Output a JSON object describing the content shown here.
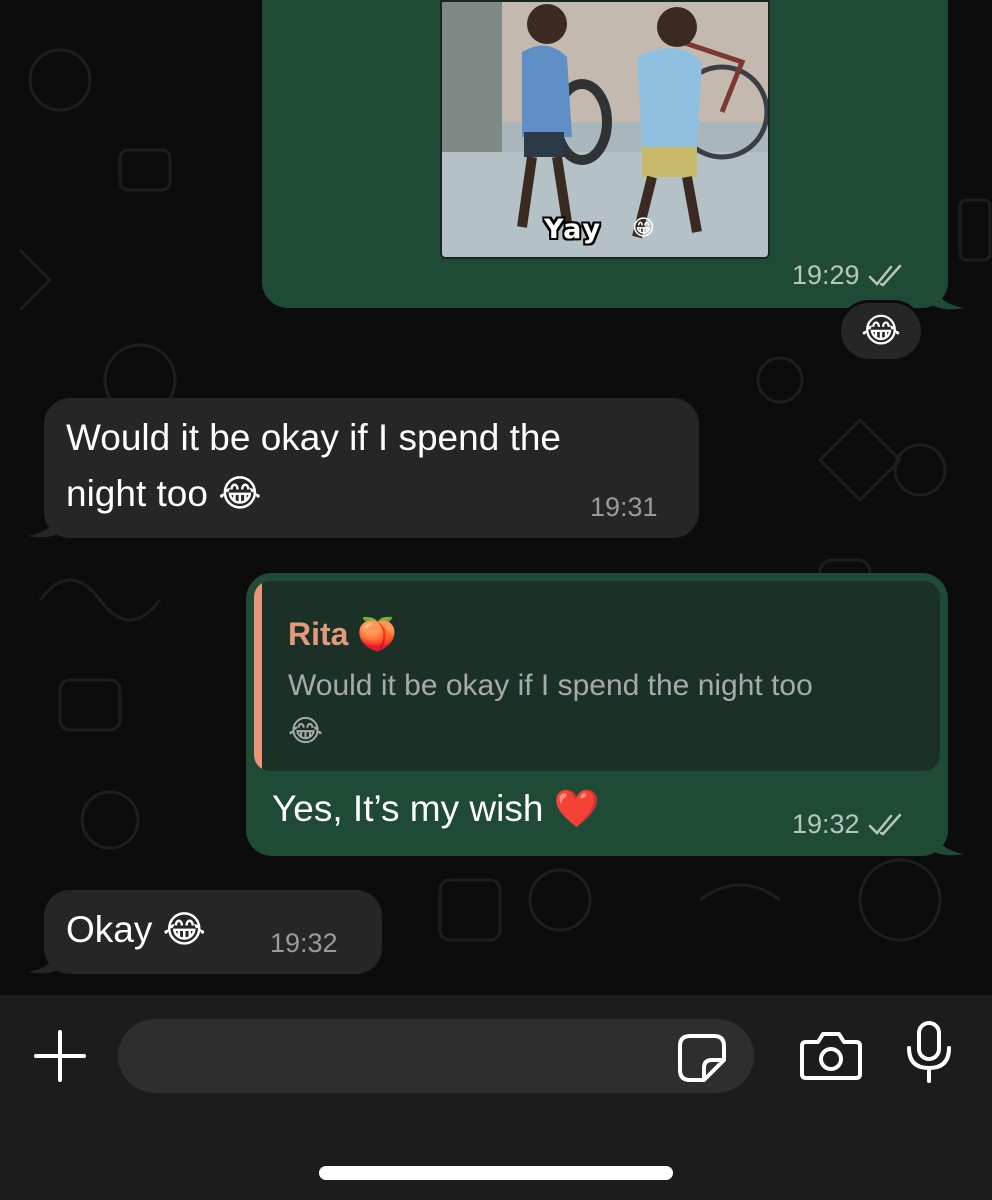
{
  "theme": {
    "outgoing_bubble": "#1f4a35",
    "incoming_bubble": "#262626",
    "quote_accent": "#e9967a",
    "background": "#0c0c0c"
  },
  "messages": [
    {
      "id": "msg-media",
      "direction": "outgoing",
      "media_caption": "Yay",
      "media_emoji": "😁",
      "time": "19:29",
      "status": "read",
      "reaction": "😂"
    },
    {
      "id": "msg-1",
      "direction": "incoming",
      "text_line1": "Would it be okay if I spend the",
      "text_line2": "night too 😂",
      "time": "19:31"
    },
    {
      "id": "msg-2",
      "direction": "outgoing",
      "quote_author": "Rita 🍑",
      "quote_text_line1": "Would it be okay if I spend the night too",
      "quote_text_line2": "😂",
      "text": "Yes, It’s my wish ❤️",
      "time": "19:32",
      "status": "read"
    },
    {
      "id": "msg-3",
      "direction": "incoming",
      "text": "Okay 😂",
      "time": "19:32"
    }
  ],
  "composer": {
    "placeholder": "",
    "icons": [
      "plus-icon",
      "sticker-icon",
      "camera-icon",
      "microphone-icon"
    ]
  }
}
